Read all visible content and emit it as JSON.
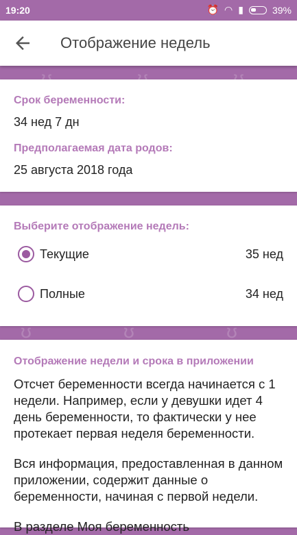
{
  "status_bar": {
    "time": "19:20",
    "battery": "39%"
  },
  "toolbar": {
    "title": "Отображение недель"
  },
  "pregnancy": {
    "term_label": "Срок беременности:",
    "term_value": "34 нед 7 дн",
    "due_label": "Предполагаемая дата родов:",
    "due_value": "25 августа 2018 года"
  },
  "week_display": {
    "title": "Выберите отображение недель:",
    "options": [
      {
        "label": "Текущие",
        "value": "35 нед",
        "selected": true
      },
      {
        "label": "Полные",
        "value": "34 нед",
        "selected": false
      }
    ]
  },
  "info": {
    "title": "Отображение недели и срока в приложении",
    "paragraphs": [
      "Отсчет беременности всегда начинается с 1 недели. Например, если у девушки идет 4 день беременности, то фактически у нее протекает первая неделя беременности.",
      "Вся информация, предоставленная в данном приложении, содержит данные о беременности, начиная с первой недели.",
      "В разделе Моя беременность"
    ]
  },
  "colors": {
    "accent": "#a36aa8",
    "label": "#b47ab8",
    "radio": "#9b5aa0"
  }
}
